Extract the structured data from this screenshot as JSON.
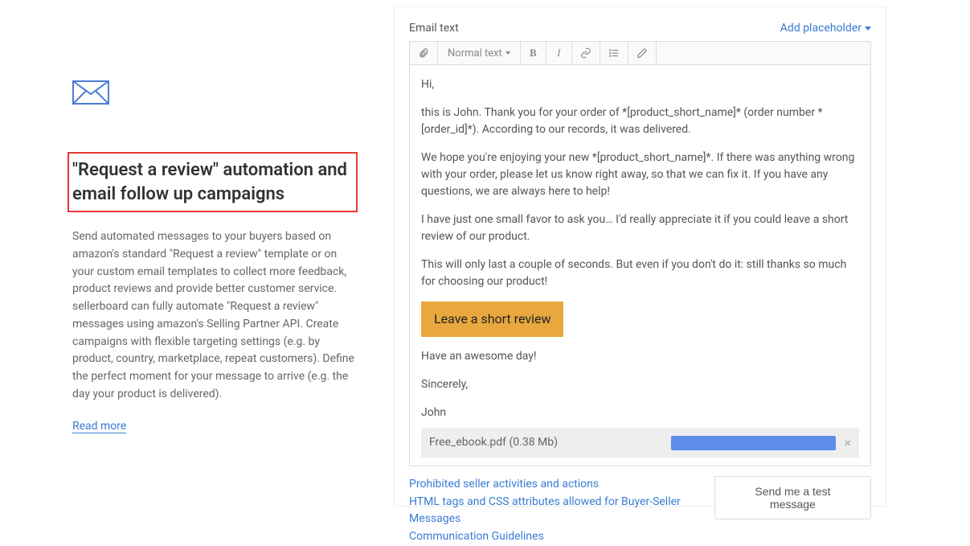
{
  "left": {
    "heading": "\"Request a review\" automation and email follow up campaigns",
    "description": "Send automated messages to your buyers based on amazon's standard \"Request a review\" template or on your custom email templates to collect more feedback, product reviews and provide better customer service. sellerboard can fully automate \"Request a review\" messages using amazon's Selling Partner API. Create campaigns with flexible targeting settings (e.g. by product, country, marketplace, repeat customers). Define the perfect moment for your message to arrive (e.g. the day your product is delivered).",
    "read_more": "Read more"
  },
  "editor": {
    "label": "Email text",
    "add_placeholder": "Add placeholder",
    "text_style": "Normal text",
    "body": {
      "p1": "Hi,",
      "p2": "this is John. Thank you for your order of *[product_short_name]* (order number *[order_id]*). According to our records, it was delivered.",
      "p3": "We hope you're enjoying your new *[product_short_name]*. If there was anything wrong with your order, please let us know right away, so that we can fix it. If you have any questions, we are always here to help!",
      "p4": "I have just one small favor to ask you… I'd really appreciate it if you could leave a short review of our product.",
      "p5": "This will only last a couple of seconds. But even if you don't do it: still thanks so much for choosing our product!",
      "cta": "Leave a short review",
      "p6": "Have an awesome day!",
      "p7": "Sincerely,",
      "p8": "John"
    },
    "attachment": {
      "name": "Free_ebook.pdf (0.38 Mb)"
    }
  },
  "footer": {
    "link1": "Prohibited seller activities and actions",
    "link2": "HTML tags and CSS attributes allowed for Buyer-Seller Messages",
    "link3": "Communication Guidelines",
    "send_test": "Send me a test message"
  }
}
